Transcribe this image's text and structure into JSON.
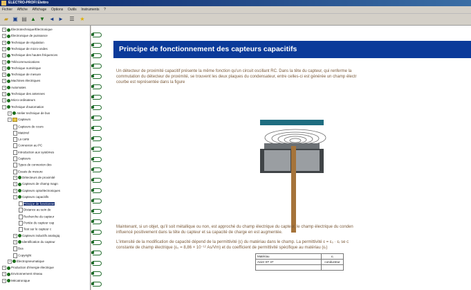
{
  "window": {
    "title": "ELECTRO-PROFI Elettro"
  },
  "menu": [
    "Fichier",
    "Affiche",
    "Affichage",
    "Options",
    "Outils",
    "Instruments",
    "?"
  ],
  "toolbar": {
    "icons": [
      "folder-open-icon",
      "save-icon",
      "print-icon",
      "up-icon",
      "down-icon",
      "back-icon",
      "forward-icon",
      "list-icon",
      "star-icon"
    ]
  },
  "tree": [
    {
      "label": "Électrotechnique/Électronique",
      "level": 0,
      "sign": "+",
      "icon": "globe"
    },
    {
      "label": "Électronique de puissance",
      "level": 0,
      "sign": "+",
      "icon": "globe"
    },
    {
      "label": "Technique de régulation",
      "level": 0,
      "sign": "+",
      "icon": "globe"
    },
    {
      "label": "Technique de micro-ondes",
      "level": 0,
      "sign": "+",
      "icon": "globe"
    },
    {
      "label": "Technique des hautes fréquences",
      "level": 0,
      "sign": "+",
      "icon": "globe"
    },
    {
      "label": "Télécommunications",
      "level": 0,
      "sign": "+",
      "icon": "globe"
    },
    {
      "label": "Technique numérique",
      "level": 0,
      "sign": "+",
      "icon": "globe"
    },
    {
      "label": "Technique de mesure",
      "level": 0,
      "sign": "+",
      "icon": "globe"
    },
    {
      "label": "Machines électriques",
      "level": 0,
      "sign": "+",
      "icon": "globe"
    },
    {
      "label": "Automates",
      "level": 0,
      "sign": "+",
      "icon": "globe"
    },
    {
      "label": "Technique des antennes",
      "level": 0,
      "sign": "+",
      "icon": "globe"
    },
    {
      "label": "Micro-ordinateurs",
      "level": 0,
      "sign": "+",
      "icon": "globe"
    },
    {
      "label": "Technique d'automation",
      "level": 0,
      "sign": "−",
      "icon": "globe"
    },
    {
      "label": "Atelier technique de bus",
      "level": 1,
      "sign": "+",
      "icon": "globe"
    },
    {
      "label": "Capteurs",
      "level": 1,
      "sign": "−",
      "icon": "folder"
    },
    {
      "label": "Capteurs de cours",
      "level": 2,
      "sign": "",
      "icon": "doc"
    },
    {
      "label": "Matériel",
      "level": 2,
      "sign": "",
      "icon": "doc"
    },
    {
      "label": "La carte",
      "level": 2,
      "sign": "",
      "icon": "doc"
    },
    {
      "label": "Connexion au PC",
      "level": 2,
      "sign": "",
      "icon": "doc"
    },
    {
      "label": "Introduction aux systèmes",
      "level": 2,
      "sign": "",
      "icon": "doc"
    },
    {
      "label": "Capteurs",
      "level": 2,
      "sign": "",
      "icon": "doc"
    },
    {
      "label": "Types de connexion des",
      "level": 2,
      "sign": "",
      "icon": "doc"
    },
    {
      "label": "Essais de mesure",
      "level": 2,
      "sign": "",
      "icon": "doc"
    },
    {
      "label": "Détecteurs de proximité",
      "level": 2,
      "sign": "+",
      "icon": "globe"
    },
    {
      "label": "Capteurs de champ magn",
      "level": 2,
      "sign": "+",
      "icon": "globe"
    },
    {
      "label": "Capteurs optoélectroniques",
      "level": 2,
      "sign": "+",
      "icon": "globe"
    },
    {
      "label": "Capteurs capacitifs",
      "level": 2,
      "sign": "−",
      "icon": "globe"
    },
    {
      "label": "Principe de fonctionne",
      "level": 3,
      "sign": "",
      "icon": "doc",
      "selected": true
    },
    {
      "label": "Distance au sein de",
      "level": 3,
      "sign": "",
      "icon": "doc"
    },
    {
      "label": "Recherche du capteur",
      "level": 3,
      "sign": "",
      "icon": "doc"
    },
    {
      "label": "Portée du capteur cap",
      "level": 3,
      "sign": "",
      "icon": "doc"
    },
    {
      "label": "Test sur le capteur c",
      "level": 3,
      "sign": "",
      "icon": "doc"
    },
    {
      "label": "Capteurs inductifs analogiq",
      "level": 2,
      "sign": "+",
      "icon": "globe"
    },
    {
      "label": "Identification du capteur",
      "level": 2,
      "sign": "+",
      "icon": "globe"
    },
    {
      "label": "Bus",
      "level": 2,
      "sign": "",
      "icon": "doc"
    },
    {
      "label": "Copyright",
      "level": 2,
      "sign": "",
      "icon": "doc"
    },
    {
      "label": "Électropneumatique",
      "level": 1,
      "sign": "+",
      "icon": "globe"
    },
    {
      "label": "Production d'énergie électrique",
      "level": 0,
      "sign": "+",
      "icon": "globe"
    },
    {
      "label": "Environnement réseau",
      "level": 0,
      "sign": "+",
      "icon": "globe"
    },
    {
      "label": "Mécatronique",
      "level": 0,
      "sign": "+",
      "icon": "globe"
    }
  ],
  "content": {
    "heading": "Principe de fonctionnement des capteurs capacitifs",
    "paragraph1": [
      "Un détecteur de proximité capacitif présente la même fonction qu'un circuit oscillant RC. Dans la tête du capteur, qui renferme la",
      "commutation du détecteur de proximité, se trouvent les deux plaques du condensateur, entre celles-ci est générée un champ électr",
      "courbe est représentée dans la figure"
    ],
    "paragraph2": [
      "Maintenant, si un objet, qu'il soit métallique ou non, est approché du champ électrique du capteur, le champ électrique du conden",
      "influencé positivement dans la tête du capteur et sa capacité de charge en est augmentée."
    ],
    "paragraph3": [
      "L'intensité de la modification de capacité dépend de la permittivité (ε) du matériau dans le champ. La permittivité ε = ε₀ · εᵣ se c",
      "constante de champ électrique (ε₀ = 8,86 × 10⁻¹² As/Vm) et du coefficient de permittivité spécifique au matériau (εᵣ)"
    ],
    "table": {
      "headers": [
        "Matériau",
        "εᵣ"
      ],
      "rows": [
        [
          "Acier ST 37",
          "conducteur"
        ],
        [
          "",
          ""
        ]
      ]
    }
  },
  "colors": {
    "banner": "#0b3a9a",
    "text": "#7a5a3a",
    "ring": "#1f6b2a",
    "sensor_cap": "#1e6d80",
    "sensor_body": "#3f4346",
    "sensor_rod": "#a5733a"
  }
}
